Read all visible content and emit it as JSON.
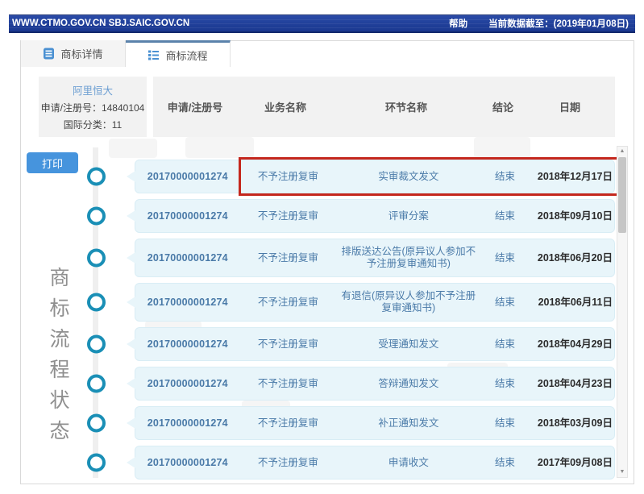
{
  "topbar": {
    "site": "WWW.CTMO.GOV.CN SBJ.SAIC.GOV.CN",
    "help": "帮助",
    "data_as_of": "当前数据截至：(2019年01月08日)"
  },
  "tabs": {
    "detail": "商标详情",
    "process": "商标流程"
  },
  "info": {
    "name": "阿里恒大",
    "reg_no": "申请/注册号：14840104",
    "intl_class": "国际分类：11"
  },
  "print_label": "打印",
  "side_label": "商标流程状态",
  "table": {
    "headers": [
      "申请/注册号",
      "业务名称",
      "环节名称",
      "结论",
      "日期"
    ],
    "rows": [
      {
        "reg_no": "20170000001274",
        "business": "不予注册复审",
        "stage": "实审裁文发文",
        "conclusion": "结束",
        "date": "2018年12月17日",
        "highlighted": true
      },
      {
        "reg_no": "20170000001274",
        "business": "不予注册复审",
        "stage": "评审分案",
        "conclusion": "结束",
        "date": "2018年09月10日",
        "highlighted": false
      },
      {
        "reg_no": "20170000001274",
        "business": "不予注册复审",
        "stage": "排版送达公告(原异议人参加不予注册复审通知书)",
        "conclusion": "结束",
        "date": "2018年06月20日",
        "highlighted": false
      },
      {
        "reg_no": "20170000001274",
        "business": "不予注册复审",
        "stage": "有退信(原异议人参加不予注册复审通知书)",
        "conclusion": "结束",
        "date": "2018年06月11日",
        "highlighted": false
      },
      {
        "reg_no": "20170000001274",
        "business": "不予注册复审",
        "stage": "受理通知发文",
        "conclusion": "结束",
        "date": "2018年04月29日",
        "highlighted": false
      },
      {
        "reg_no": "20170000001274",
        "business": "不予注册复审",
        "stage": "答辩通知发文",
        "conclusion": "结束",
        "date": "2018年04月23日",
        "highlighted": false
      },
      {
        "reg_no": "20170000001274",
        "business": "不予注册复审",
        "stage": "补正通知发文",
        "conclusion": "结束",
        "date": "2018年03月09日",
        "highlighted": false
      },
      {
        "reg_no": "20170000001274",
        "business": "不予注册复审",
        "stage": "申请收文",
        "conclusion": "结束",
        "date": "2017年09月08日",
        "highlighted": false
      }
    ]
  },
  "scrollbar": {
    "up_glyph": "▲",
    "down_glyph": "▼"
  },
  "colors": {
    "topbar_navy": "#203f99",
    "accent_blue": "#4694dd",
    "timeline_teal": "#1a8fb6",
    "highlight_red": "#c4271d",
    "row_bg": "#e8f5fa",
    "tab_icon_blue": "#4a90d2"
  }
}
